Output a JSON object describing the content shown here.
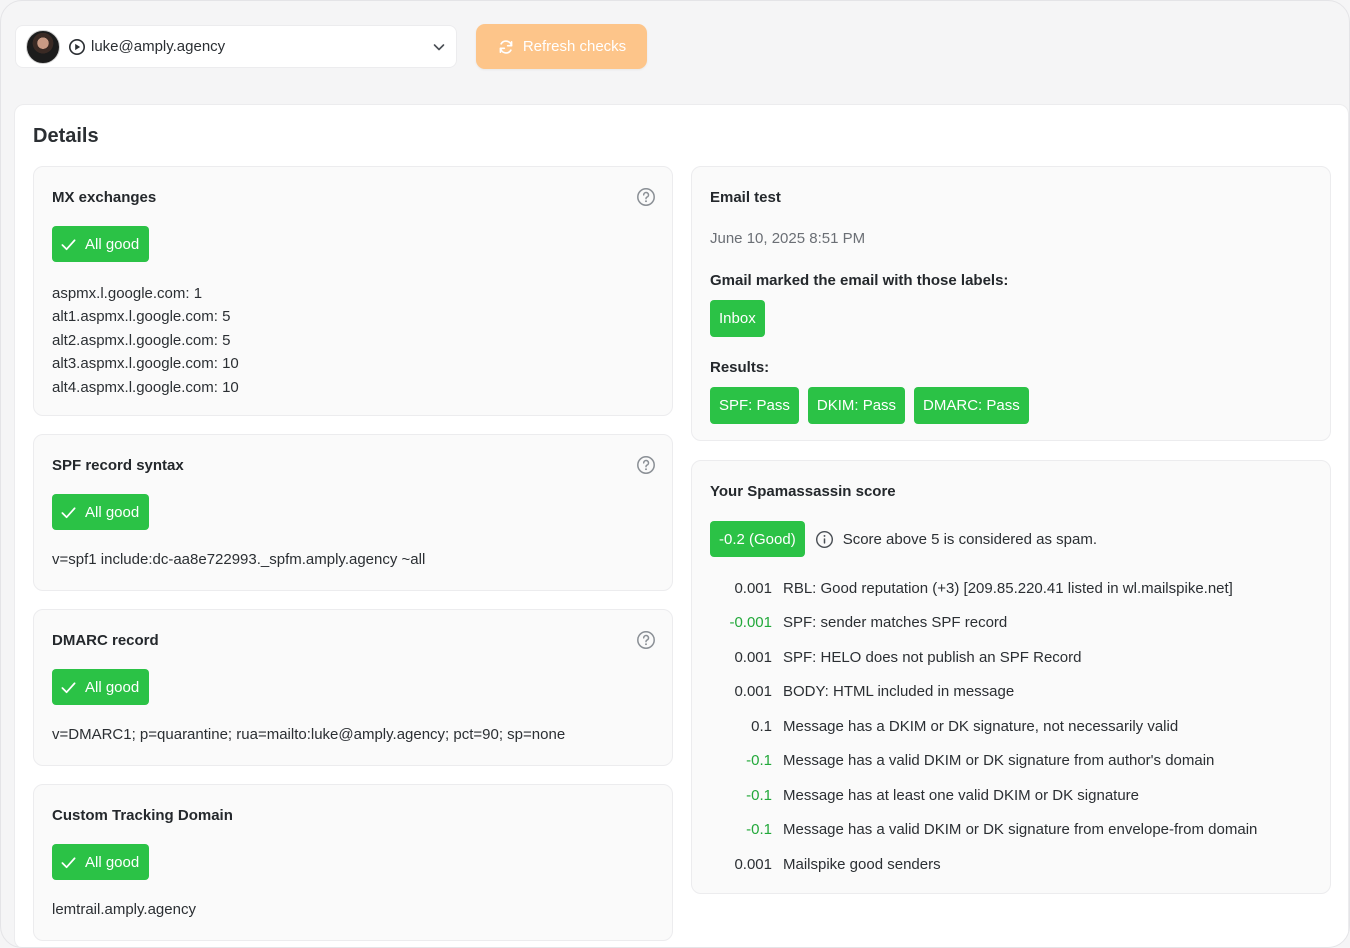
{
  "topbar": {
    "account_email": "luke@amply.agency",
    "refresh_label": "Refresh checks"
  },
  "details": {
    "title": "Details",
    "mx": {
      "title": "MX exchanges",
      "status": "All good",
      "records": [
        "aspmx.l.google.com: 1",
        "alt1.aspmx.l.google.com: 5",
        "alt2.aspmx.l.google.com: 5",
        "alt3.aspmx.l.google.com: 10",
        "alt4.aspmx.l.google.com: 10"
      ]
    },
    "spf": {
      "title": "SPF record syntax",
      "status": "All good",
      "value": "v=spf1 include:dc-aa8e722993._spfm.amply.agency ~all"
    },
    "dmarc": {
      "title": "DMARC record",
      "status": "All good",
      "value": "v=DMARC1; p=quarantine; rua=mailto:luke@amply.agency; pct=90; sp=none"
    },
    "tracking": {
      "title": "Custom Tracking Domain",
      "status": "All good",
      "value": "lemtrail.amply.agency"
    },
    "email_test": {
      "title": "Email test",
      "date": "June 10, 2025 8:51 PM",
      "labels_heading": "Gmail marked the email with those labels:",
      "labels": [
        "Inbox"
      ],
      "results_heading": "Results:",
      "results": [
        "SPF: Pass",
        "DKIM: Pass",
        "DMARC: Pass"
      ]
    },
    "spam": {
      "title": "Your Spamassassin score",
      "score_badge": "-0.2 (Good)",
      "hint": "Score above 5 is considered as spam.",
      "rows": [
        {
          "value": "0.001",
          "desc": "RBL: Good reputation (+3) [209.85.220.41 listed in wl.mailspike.net]"
        },
        {
          "value": "-0.001",
          "desc": "SPF: sender matches SPF record"
        },
        {
          "value": "0.001",
          "desc": "SPF: HELO does not publish an SPF Record"
        },
        {
          "value": "0.001",
          "desc": "BODY: HTML included in message"
        },
        {
          "value": "0.1",
          "desc": "Message has a DKIM or DK signature, not necessarily valid"
        },
        {
          "value": "-0.1",
          "desc": "Message has a valid DKIM or DK signature from author's domain"
        },
        {
          "value": "-0.1",
          "desc": "Message has at least one valid DKIM or DK signature"
        },
        {
          "value": "-0.1",
          "desc": "Message has a valid DKIM or DK signature from envelope-from domain"
        },
        {
          "value": "0.001",
          "desc": "Mailspike good senders"
        }
      ]
    }
  },
  "colors": {
    "accent_green": "#2bc246",
    "negative_score_green": "#22a83a",
    "refresh_orange": "#fdc58a"
  },
  "icons": {
    "play": "play-circle-icon",
    "chevron": "chevron-down-icon",
    "refresh": "refresh-icon",
    "check": "check-icon",
    "help": "help-circle-icon",
    "info": "info-circle-icon"
  }
}
